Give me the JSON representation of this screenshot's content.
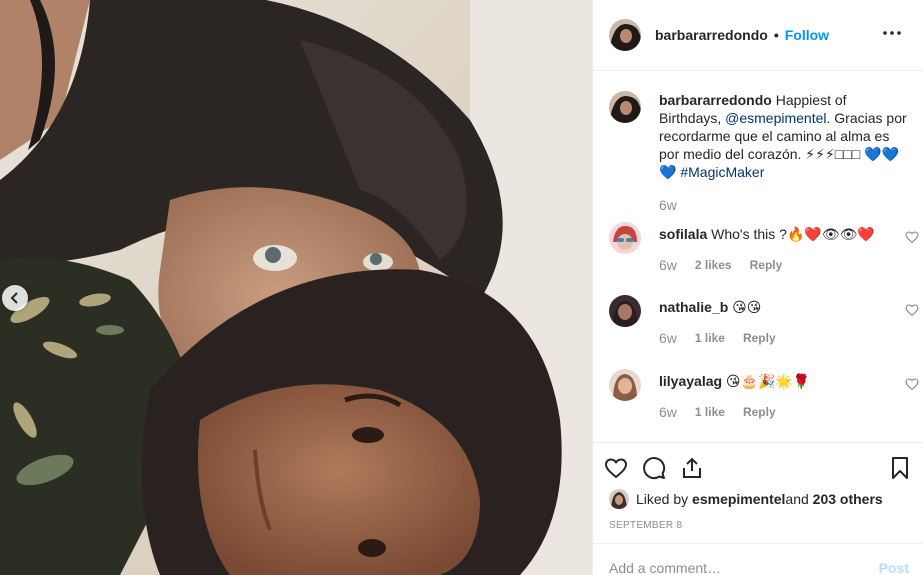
{
  "header": {
    "username": "barbararredondo",
    "separator": "•",
    "follow_label": "Follow",
    "more_icon": "more-horizontal-icon"
  },
  "caption": {
    "username": "barbararredondo",
    "text_before_mention": " Happiest of Birthdays, ",
    "mention": "@esmepimentel",
    "text_after_mention": ". Gracias por recordarme que el camino al alma es por medio del corazón. ⚡⚡⚡□□□ 💙💙💙 ",
    "hashtag": "#MagicMaker",
    "time": "6w"
  },
  "comments": [
    {
      "username": "sofilala",
      "text": " Who's this ?🔥❤️👁👁❤️",
      "time": "6w",
      "likes": "2 likes",
      "reply": "Reply"
    },
    {
      "username": "nathalie_b",
      "text": " 😘😘",
      "time": "6w",
      "likes": "1 like",
      "reply": "Reply"
    },
    {
      "username": "lilyayalag",
      "text": " 😘🎂🎉🌟🌹",
      "time": "6w",
      "likes": "1 like",
      "reply": "Reply"
    }
  ],
  "likes": {
    "prefix": "Liked by ",
    "user": "esmepimentel",
    "middle": " and ",
    "others": "203 others"
  },
  "date": "September 8",
  "add_comment": {
    "placeholder": "Add a comment…",
    "post_label": "Post"
  },
  "colors": {
    "accent": "#0095f6",
    "link": "#00376b",
    "muted": "#8e8e8e",
    "post_disabled": "#b2dffc"
  }
}
